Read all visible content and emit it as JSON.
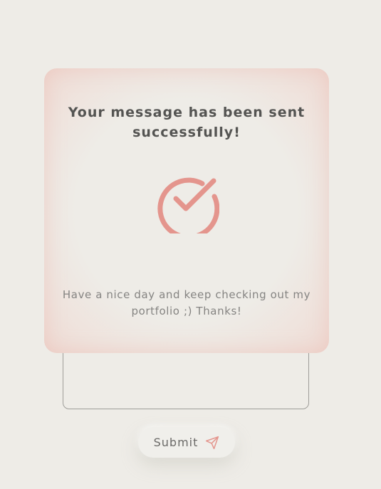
{
  "modal": {
    "title": "Your message has been sent successfully!",
    "message": "Have a nice day and keep checking out my portfolio ;) Thanks!",
    "icon": "check-circle-icon",
    "accent_color": "#e4958d"
  },
  "form": {
    "message_field_value": "",
    "submit_label": "Submit",
    "submit_icon": "send-icon"
  }
}
